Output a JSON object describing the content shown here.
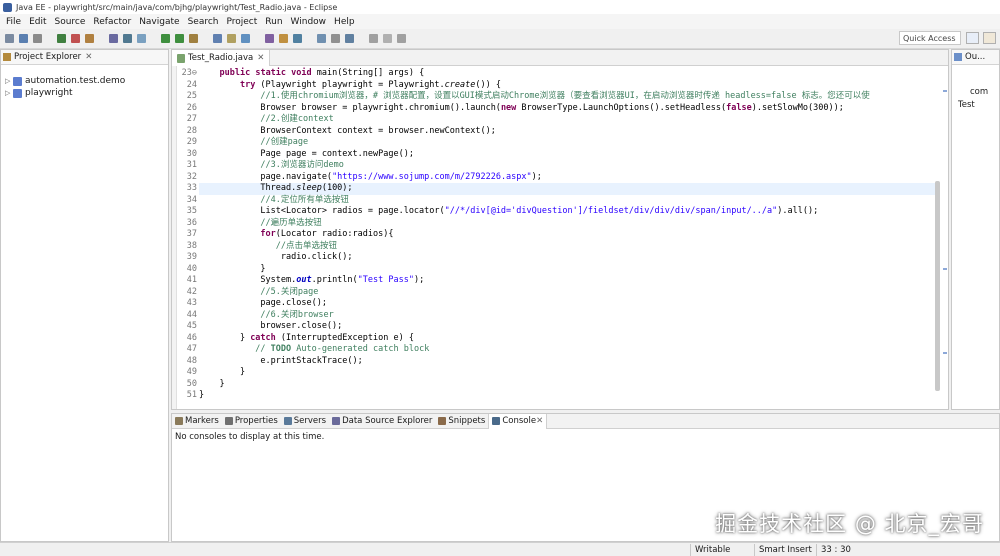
{
  "window": {
    "title": "Java EE - playwright/src/main/java/com/bjhg/playwright/Test_Radio.java - Eclipse"
  },
  "menu": [
    "File",
    "Edit",
    "Source",
    "Refactor",
    "Navigate",
    "Search",
    "Project",
    "Run",
    "Window",
    "Help"
  ],
  "toolbar": {
    "quick_access": "Quick Access"
  },
  "explorer": {
    "tab": "Project Explorer",
    "close": "✕",
    "items": [
      {
        "label": "automation.test.demo"
      },
      {
        "label": "playwright"
      }
    ]
  },
  "editor": {
    "tab": "Test_Radio.java",
    "lines": [
      {
        "n": "23⊖",
        "html": "    <span class=\"kw\">public</span> <span class=\"kw\">static</span> <span class=\"kw\">void</span> main(String[] args) {"
      },
      {
        "n": "24",
        "html": "        <span class=\"kw\">try</span> (Playwright playwright = Playwright.<span class=\"it\">create</span>()) {"
      },
      {
        "n": "25",
        "html": "            <span class=\"cm\">//1.使用chromium浏览器，# 浏览器配置，设置以GUI模式启动Chrome浏览器（要查看浏览器UI，在启动浏览器时传递 headless=false 标志。您还可以使</span>"
      },
      {
        "n": "26",
        "html": "            Browser browser = playwright.chromium().launch(<span class=\"kw\">new</span> BrowserType.LaunchOptions().setHeadless(<span class=\"kw\">false</span>).setSlowMo(300));"
      },
      {
        "n": "27",
        "html": "            <span class=\"cm\">//2.创建context</span>"
      },
      {
        "n": "28",
        "html": "            BrowserContext context = browser.newContext();"
      },
      {
        "n": "29",
        "html": "            <span class=\"cm\">//创建page</span>"
      },
      {
        "n": "30",
        "html": "            Page page = context.newPage();"
      },
      {
        "n": "31",
        "html": "            <span class=\"cm\">//3.浏览器访问demo</span>"
      },
      {
        "n": "32",
        "html": "            page.navigate(<span class=\"st\">\"https://www.sojump.com/m/2792226.aspx\"</span>);"
      },
      {
        "n": "33",
        "html": "            Thread.<span class=\"it\">sleep</span>(100);"
      },
      {
        "n": "34",
        "html": "            <span class=\"cm\">//4.定位所有单选按钮</span>"
      },
      {
        "n": "35",
        "html": "            List&lt;Locator&gt; radios = page.locator(<span class=\"st\">\"//*/div[@id='divQuestion']/fieldset/div/div/div/span/input/../a\"</span>).all();"
      },
      {
        "n": "36",
        "html": "            <span class=\"cm\">//遍历单选按钮</span>"
      },
      {
        "n": "37",
        "html": "            <span class=\"kw\">for</span>(Locator radio:radios){"
      },
      {
        "n": "38",
        "html": "               <span class=\"cm\">//点击单选按钮</span>"
      },
      {
        "n": "39",
        "html": "                radio.click();"
      },
      {
        "n": "40",
        "html": "            }"
      },
      {
        "n": "41",
        "html": "            System.<span class=\"fd it\">out</span>.println(<span class=\"st\">\"Test Pass\"</span>);"
      },
      {
        "n": "42",
        "html": "            <span class=\"cm\">//5.关闭page</span>"
      },
      {
        "n": "43",
        "html": "            page.close();"
      },
      {
        "n": "44",
        "html": "            <span class=\"cm\">//6.关闭browser</span>"
      },
      {
        "n": "45",
        "html": "            browser.close();"
      },
      {
        "n": "46",
        "html": "        } <span class=\"kw\">catch</span> (InterruptedException e) {"
      },
      {
        "n": "47",
        "html": "           <span class=\"cm\">// <b>TODO</b> Auto-generated catch block</span>"
      },
      {
        "n": "48",
        "html": "            e.printStackTrace();"
      },
      {
        "n": "49",
        "html": "        }"
      },
      {
        "n": "50",
        "html": "    }"
      },
      {
        "n": "51",
        "html": "}"
      }
    ]
  },
  "outline": {
    "tab": "Ou...",
    "items": [
      "com",
      "Test"
    ]
  },
  "bottom": {
    "tabs": [
      "Markers",
      "Properties",
      "Servers",
      "Data Source Explorer",
      "Snippets",
      "Console"
    ],
    "selected": "Console",
    "message": "No consoles to display at this time."
  },
  "status": {
    "writable": "Writable",
    "insert": "Smart Insert",
    "position": "33 : 30"
  },
  "watermark": "掘金技术社区 @ 北京_宏哥"
}
